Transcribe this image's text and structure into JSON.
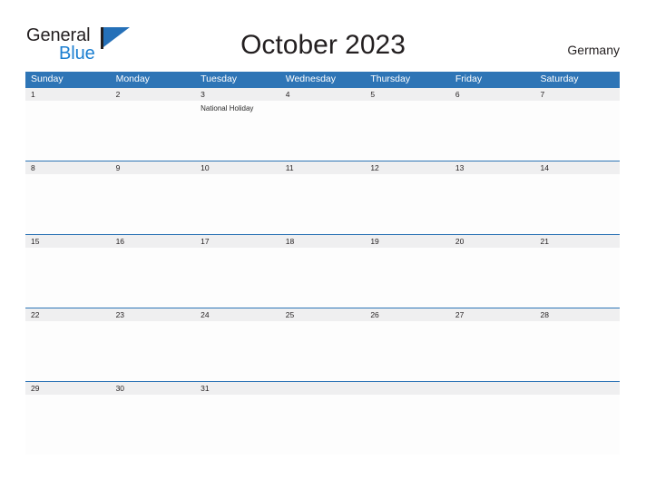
{
  "brand": {
    "name_part1": "General",
    "name_part2": "Blue",
    "mark_icon": "flag-triangle-icon",
    "color_primary": "#2570b8",
    "color_text": "#231f20"
  },
  "header": {
    "title": "October 2023",
    "country": "Germany"
  },
  "calendar": {
    "header_bg": "#2e75b6",
    "date_band_bg": "#efeff0",
    "grid_line_color": "#2e75b6",
    "day_names": [
      "Sunday",
      "Monday",
      "Tuesday",
      "Wednesday",
      "Thursday",
      "Friday",
      "Saturday"
    ],
    "weeks": [
      {
        "days": [
          {
            "date": "1",
            "event": ""
          },
          {
            "date": "2",
            "event": ""
          },
          {
            "date": "3",
            "event": "National Holiday"
          },
          {
            "date": "4",
            "event": ""
          },
          {
            "date": "5",
            "event": ""
          },
          {
            "date": "6",
            "event": ""
          },
          {
            "date": "7",
            "event": ""
          }
        ]
      },
      {
        "days": [
          {
            "date": "8",
            "event": ""
          },
          {
            "date": "9",
            "event": ""
          },
          {
            "date": "10",
            "event": ""
          },
          {
            "date": "11",
            "event": ""
          },
          {
            "date": "12",
            "event": ""
          },
          {
            "date": "13",
            "event": ""
          },
          {
            "date": "14",
            "event": ""
          }
        ]
      },
      {
        "days": [
          {
            "date": "15",
            "event": ""
          },
          {
            "date": "16",
            "event": ""
          },
          {
            "date": "17",
            "event": ""
          },
          {
            "date": "18",
            "event": ""
          },
          {
            "date": "19",
            "event": ""
          },
          {
            "date": "20",
            "event": ""
          },
          {
            "date": "21",
            "event": ""
          }
        ]
      },
      {
        "days": [
          {
            "date": "22",
            "event": ""
          },
          {
            "date": "23",
            "event": ""
          },
          {
            "date": "24",
            "event": ""
          },
          {
            "date": "25",
            "event": ""
          },
          {
            "date": "26",
            "event": ""
          },
          {
            "date": "27",
            "event": ""
          },
          {
            "date": "28",
            "event": ""
          }
        ]
      },
      {
        "days": [
          {
            "date": "29",
            "event": ""
          },
          {
            "date": "30",
            "event": ""
          },
          {
            "date": "31",
            "event": ""
          },
          {
            "date": "",
            "event": ""
          },
          {
            "date": "",
            "event": ""
          },
          {
            "date": "",
            "event": ""
          },
          {
            "date": "",
            "event": ""
          }
        ]
      }
    ]
  }
}
